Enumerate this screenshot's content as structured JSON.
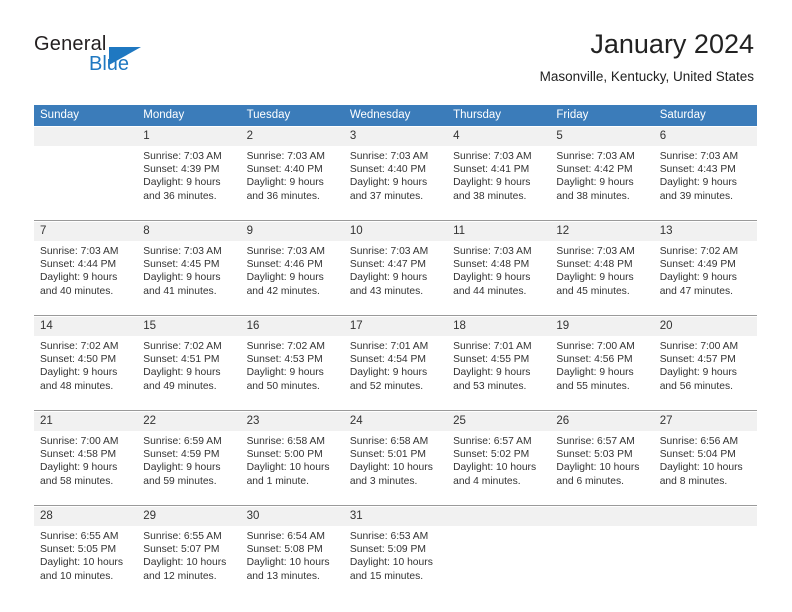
{
  "brand": {
    "name_part1": "General",
    "name_part2": "Blue",
    "accent_color": "#1f78c1"
  },
  "header": {
    "title": "January 2024",
    "subtitle": "Masonville, Kentucky, United States"
  },
  "calendar": {
    "header_bg": "#3b7cba",
    "daynum_bg": "#f1f1f1",
    "weekday_headers": [
      "Sunday",
      "Monday",
      "Tuesday",
      "Wednesday",
      "Thursday",
      "Friday",
      "Saturday"
    ],
    "weeks": [
      [
        {
          "day": "",
          "sunrise": "",
          "sunset": "",
          "daylight1": "",
          "daylight2": ""
        },
        {
          "day": "1",
          "sunrise": "Sunrise: 7:03 AM",
          "sunset": "Sunset: 4:39 PM",
          "daylight1": "Daylight: 9 hours",
          "daylight2": "and 36 minutes."
        },
        {
          "day": "2",
          "sunrise": "Sunrise: 7:03 AM",
          "sunset": "Sunset: 4:40 PM",
          "daylight1": "Daylight: 9 hours",
          "daylight2": "and 36 minutes."
        },
        {
          "day": "3",
          "sunrise": "Sunrise: 7:03 AM",
          "sunset": "Sunset: 4:40 PM",
          "daylight1": "Daylight: 9 hours",
          "daylight2": "and 37 minutes."
        },
        {
          "day": "4",
          "sunrise": "Sunrise: 7:03 AM",
          "sunset": "Sunset: 4:41 PM",
          "daylight1": "Daylight: 9 hours",
          "daylight2": "and 38 minutes."
        },
        {
          "day": "5",
          "sunrise": "Sunrise: 7:03 AM",
          "sunset": "Sunset: 4:42 PM",
          "daylight1": "Daylight: 9 hours",
          "daylight2": "and 38 minutes."
        },
        {
          "day": "6",
          "sunrise": "Sunrise: 7:03 AM",
          "sunset": "Sunset: 4:43 PM",
          "daylight1": "Daylight: 9 hours",
          "daylight2": "and 39 minutes."
        }
      ],
      [
        {
          "day": "7",
          "sunrise": "Sunrise: 7:03 AM",
          "sunset": "Sunset: 4:44 PM",
          "daylight1": "Daylight: 9 hours",
          "daylight2": "and 40 minutes."
        },
        {
          "day": "8",
          "sunrise": "Sunrise: 7:03 AM",
          "sunset": "Sunset: 4:45 PM",
          "daylight1": "Daylight: 9 hours",
          "daylight2": "and 41 minutes."
        },
        {
          "day": "9",
          "sunrise": "Sunrise: 7:03 AM",
          "sunset": "Sunset: 4:46 PM",
          "daylight1": "Daylight: 9 hours",
          "daylight2": "and 42 minutes."
        },
        {
          "day": "10",
          "sunrise": "Sunrise: 7:03 AM",
          "sunset": "Sunset: 4:47 PM",
          "daylight1": "Daylight: 9 hours",
          "daylight2": "and 43 minutes."
        },
        {
          "day": "11",
          "sunrise": "Sunrise: 7:03 AM",
          "sunset": "Sunset: 4:48 PM",
          "daylight1": "Daylight: 9 hours",
          "daylight2": "and 44 minutes."
        },
        {
          "day": "12",
          "sunrise": "Sunrise: 7:03 AM",
          "sunset": "Sunset: 4:48 PM",
          "daylight1": "Daylight: 9 hours",
          "daylight2": "and 45 minutes."
        },
        {
          "day": "13",
          "sunrise": "Sunrise: 7:02 AM",
          "sunset": "Sunset: 4:49 PM",
          "daylight1": "Daylight: 9 hours",
          "daylight2": "and 47 minutes."
        }
      ],
      [
        {
          "day": "14",
          "sunrise": "Sunrise: 7:02 AM",
          "sunset": "Sunset: 4:50 PM",
          "daylight1": "Daylight: 9 hours",
          "daylight2": "and 48 minutes."
        },
        {
          "day": "15",
          "sunrise": "Sunrise: 7:02 AM",
          "sunset": "Sunset: 4:51 PM",
          "daylight1": "Daylight: 9 hours",
          "daylight2": "and 49 minutes."
        },
        {
          "day": "16",
          "sunrise": "Sunrise: 7:02 AM",
          "sunset": "Sunset: 4:53 PM",
          "daylight1": "Daylight: 9 hours",
          "daylight2": "and 50 minutes."
        },
        {
          "day": "17",
          "sunrise": "Sunrise: 7:01 AM",
          "sunset": "Sunset: 4:54 PM",
          "daylight1": "Daylight: 9 hours",
          "daylight2": "and 52 minutes."
        },
        {
          "day": "18",
          "sunrise": "Sunrise: 7:01 AM",
          "sunset": "Sunset: 4:55 PM",
          "daylight1": "Daylight: 9 hours",
          "daylight2": "and 53 minutes."
        },
        {
          "day": "19",
          "sunrise": "Sunrise: 7:00 AM",
          "sunset": "Sunset: 4:56 PM",
          "daylight1": "Daylight: 9 hours",
          "daylight2": "and 55 minutes."
        },
        {
          "day": "20",
          "sunrise": "Sunrise: 7:00 AM",
          "sunset": "Sunset: 4:57 PM",
          "daylight1": "Daylight: 9 hours",
          "daylight2": "and 56 minutes."
        }
      ],
      [
        {
          "day": "21",
          "sunrise": "Sunrise: 7:00 AM",
          "sunset": "Sunset: 4:58 PM",
          "daylight1": "Daylight: 9 hours",
          "daylight2": "and 58 minutes."
        },
        {
          "day": "22",
          "sunrise": "Sunrise: 6:59 AM",
          "sunset": "Sunset: 4:59 PM",
          "daylight1": "Daylight: 9 hours",
          "daylight2": "and 59 minutes."
        },
        {
          "day": "23",
          "sunrise": "Sunrise: 6:58 AM",
          "sunset": "Sunset: 5:00 PM",
          "daylight1": "Daylight: 10 hours",
          "daylight2": "and 1 minute."
        },
        {
          "day": "24",
          "sunrise": "Sunrise: 6:58 AM",
          "sunset": "Sunset: 5:01 PM",
          "daylight1": "Daylight: 10 hours",
          "daylight2": "and 3 minutes."
        },
        {
          "day": "25",
          "sunrise": "Sunrise: 6:57 AM",
          "sunset": "Sunset: 5:02 PM",
          "daylight1": "Daylight: 10 hours",
          "daylight2": "and 4 minutes."
        },
        {
          "day": "26",
          "sunrise": "Sunrise: 6:57 AM",
          "sunset": "Sunset: 5:03 PM",
          "daylight1": "Daylight: 10 hours",
          "daylight2": "and 6 minutes."
        },
        {
          "day": "27",
          "sunrise": "Sunrise: 6:56 AM",
          "sunset": "Sunset: 5:04 PM",
          "daylight1": "Daylight: 10 hours",
          "daylight2": "and 8 minutes."
        }
      ],
      [
        {
          "day": "28",
          "sunrise": "Sunrise: 6:55 AM",
          "sunset": "Sunset: 5:05 PM",
          "daylight1": "Daylight: 10 hours",
          "daylight2": "and 10 minutes."
        },
        {
          "day": "29",
          "sunrise": "Sunrise: 6:55 AM",
          "sunset": "Sunset: 5:07 PM",
          "daylight1": "Daylight: 10 hours",
          "daylight2": "and 12 minutes."
        },
        {
          "day": "30",
          "sunrise": "Sunrise: 6:54 AM",
          "sunset": "Sunset: 5:08 PM",
          "daylight1": "Daylight: 10 hours",
          "daylight2": "and 13 minutes."
        },
        {
          "day": "31",
          "sunrise": "Sunrise: 6:53 AM",
          "sunset": "Sunset: 5:09 PM",
          "daylight1": "Daylight: 10 hours",
          "daylight2": "and 15 minutes."
        },
        {
          "day": "",
          "sunrise": "",
          "sunset": "",
          "daylight1": "",
          "daylight2": ""
        },
        {
          "day": "",
          "sunrise": "",
          "sunset": "",
          "daylight1": "",
          "daylight2": ""
        },
        {
          "day": "",
          "sunrise": "",
          "sunset": "",
          "daylight1": "",
          "daylight2": ""
        }
      ]
    ]
  }
}
